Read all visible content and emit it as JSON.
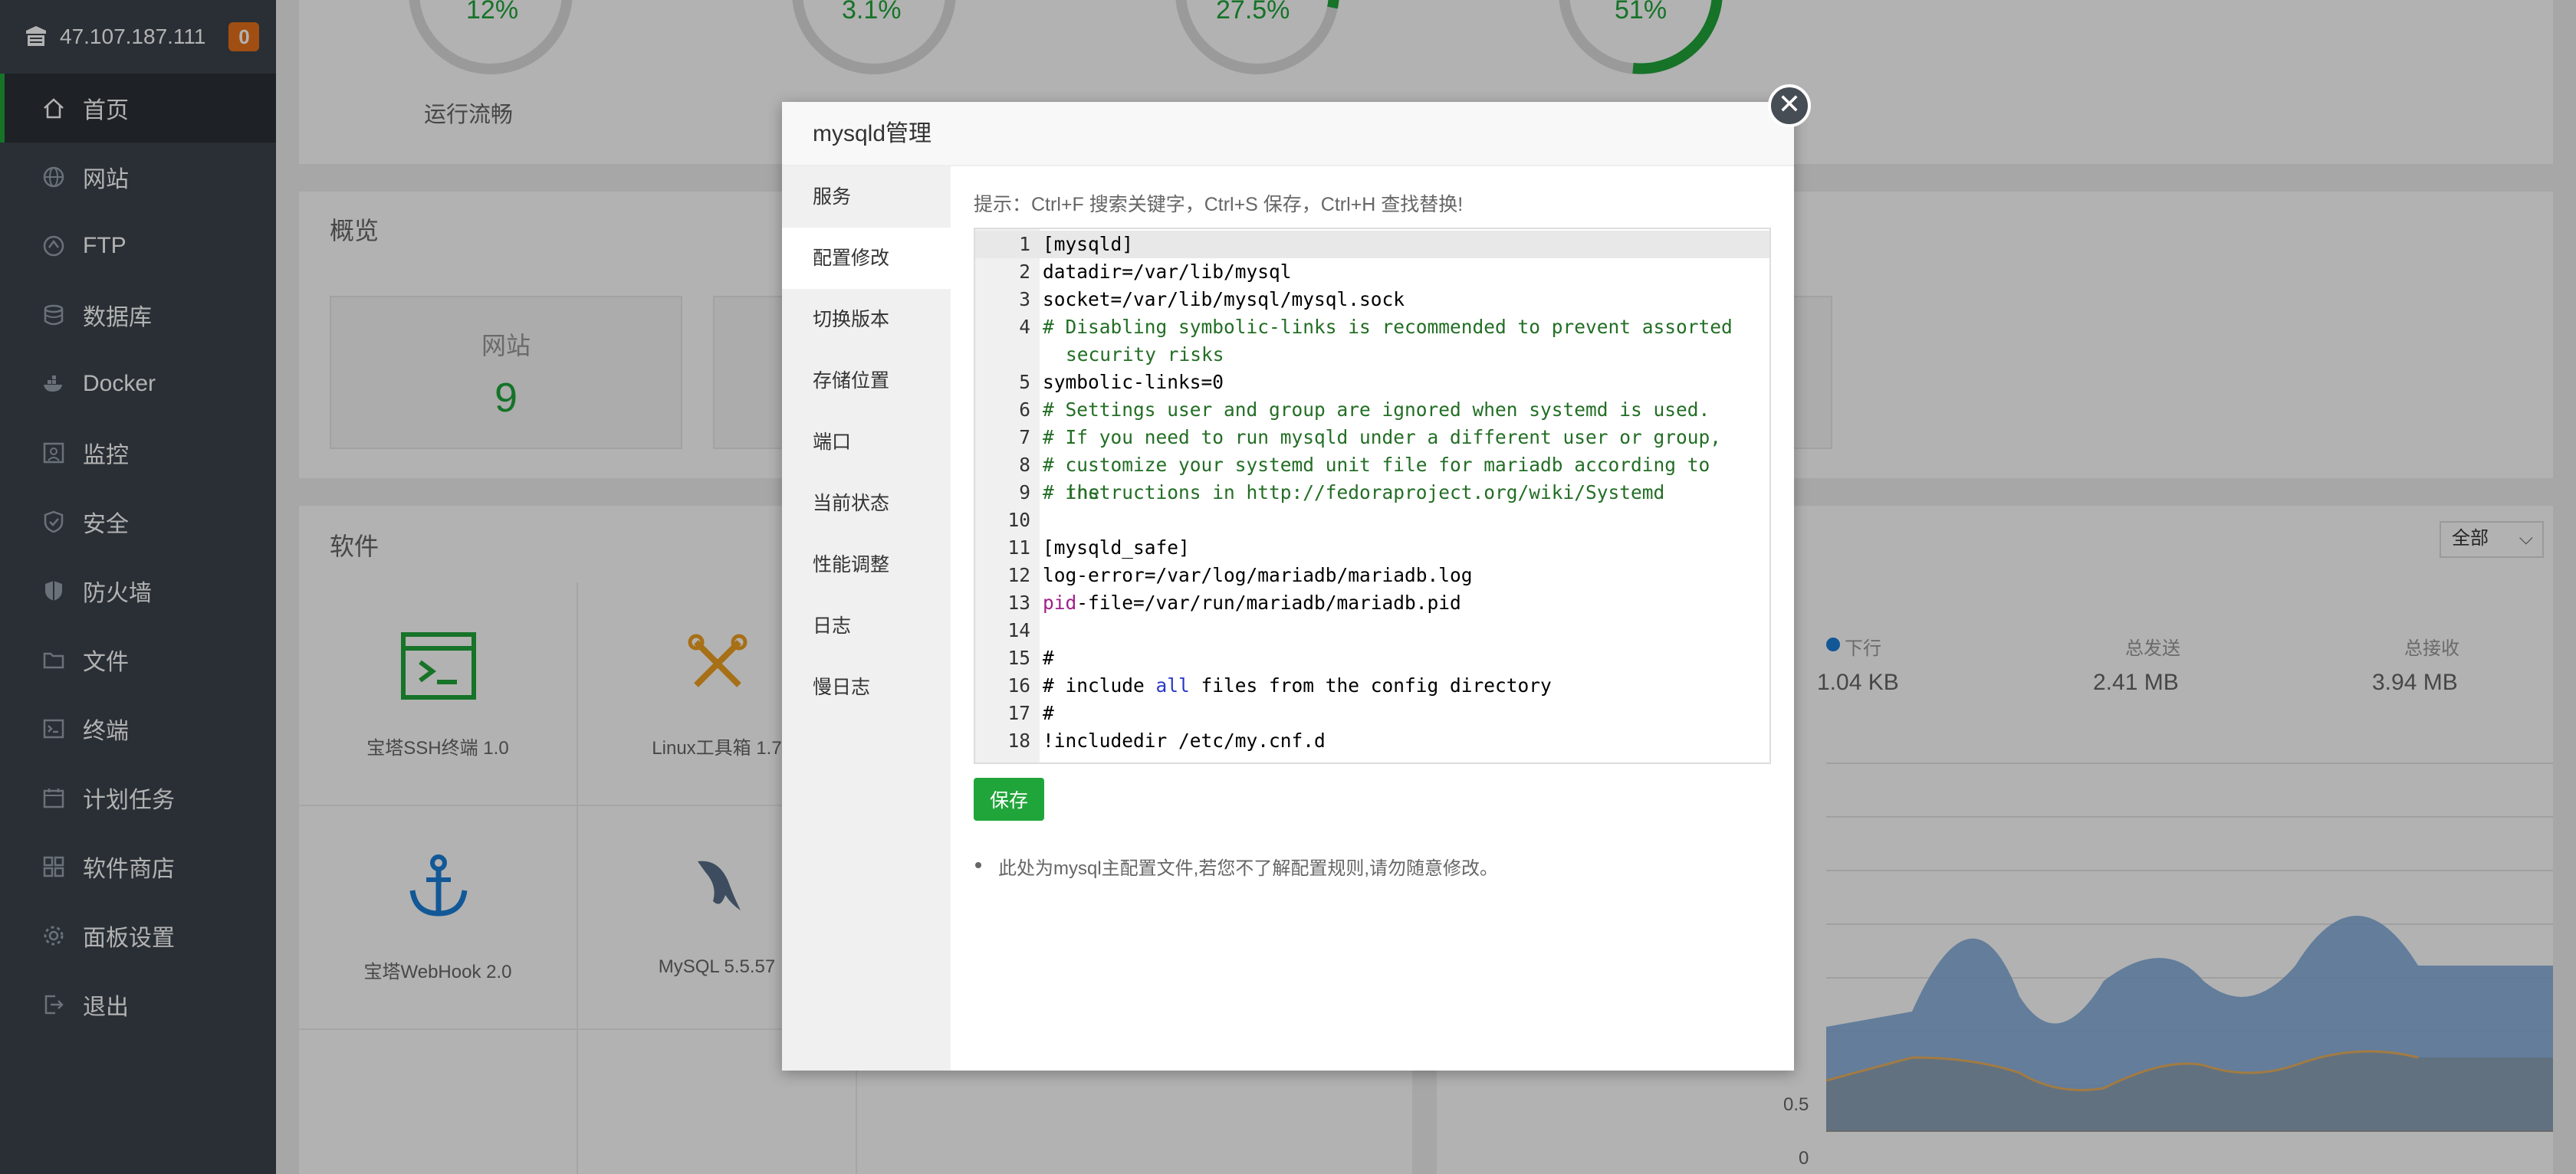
{
  "sidebar": {
    "ip": "47.107.187.111",
    "badge": "0",
    "items": [
      {
        "label": "首页",
        "icon": "home-icon"
      },
      {
        "label": "网站",
        "icon": "globe-icon"
      },
      {
        "label": "FTP",
        "icon": "ftp-icon"
      },
      {
        "label": "数据库",
        "icon": "database-icon"
      },
      {
        "label": "Docker",
        "icon": "docker-icon"
      },
      {
        "label": "监控",
        "icon": "monitor-icon"
      },
      {
        "label": "安全",
        "icon": "shield-check-icon"
      },
      {
        "label": "防火墙",
        "icon": "firewall-icon"
      },
      {
        "label": "文件",
        "icon": "folder-icon"
      },
      {
        "label": "终端",
        "icon": "terminal-icon"
      },
      {
        "label": "计划任务",
        "icon": "calendar-icon"
      },
      {
        "label": "软件商店",
        "icon": "grid-icon"
      },
      {
        "label": "面板设置",
        "icon": "gear-icon"
      },
      {
        "label": "退出",
        "icon": "logout-icon"
      }
    ]
  },
  "status": {
    "gauges": [
      {
        "pct": "12%",
        "label": "运行流畅"
      },
      {
        "pct": "3.1%",
        "label": ""
      },
      {
        "pct": "27.5%",
        "label": ""
      },
      {
        "pct": "51%",
        "label": ""
      }
    ]
  },
  "overview": {
    "title": "概览",
    "site_label": "网站",
    "site_count": "9"
  },
  "software": {
    "title": "软件",
    "filter": "全部",
    "items": [
      {
        "label": "宝塔SSH终端 1.0",
        "icon": "ssh-terminal-icon"
      },
      {
        "label": "Linux工具箱 1.7",
        "icon": "tools-icon"
      },
      {
        "label": "宝塔WebHook 2.0",
        "icon": "anchor-icon"
      },
      {
        "label": "MySQL 5.5.57",
        "icon": "mysql-dolphin-icon"
      }
    ]
  },
  "network": {
    "down_label": "下行",
    "down_value": "1.04 KB",
    "sent_label": "总发送",
    "sent_value": "2.41 MB",
    "recv_label": "总接收",
    "recv_value": "3.94 MB",
    "axis_05": "0.5",
    "axis_0": "0"
  },
  "modal": {
    "title": "mysqld管理",
    "nav": [
      "服务",
      "配置修改",
      "切换版本",
      "存储位置",
      "端口",
      "当前状态",
      "性能调整",
      "日志",
      "慢日志"
    ],
    "active_nav": "配置修改",
    "hint": "提示：Ctrl+F 搜索关键字，Ctrl+S 保存，Ctrl+H 查找替换!",
    "lines": [
      {
        "n": "1",
        "text": "[mysqld]"
      },
      {
        "n": "2",
        "text": "datadir=/var/lib/mysql"
      },
      {
        "n": "3",
        "text": "socket=/var/lib/mysql/mysql.sock"
      },
      {
        "n": "4",
        "text": "# Disabling symbolic-links is recommended to prevent assorted security risks"
      },
      {
        "n": "5",
        "text": "symbolic-links=0"
      },
      {
        "n": "6",
        "text": "# Settings user and group are ignored when systemd is used."
      },
      {
        "n": "7",
        "text": "# If you need to run mysqld under a different user or group,"
      },
      {
        "n": "8",
        "text": "# customize your systemd unit file for mariadb according to the"
      },
      {
        "n": "9",
        "text": "# instructions in http://fedoraproject.org/wiki/Systemd"
      },
      {
        "n": "10",
        "text": ""
      },
      {
        "n": "11",
        "text": "[mysqld_safe]"
      },
      {
        "n": "12",
        "text": "log-error=/var/log/mariadb/mariadb.log"
      },
      {
        "n": "13",
        "text_pre": "pid",
        "text": "-file=/var/run/mariadb/mariadb.pid"
      },
      {
        "n": "14",
        "text": ""
      },
      {
        "n": "15",
        "text": "#"
      },
      {
        "n": "16",
        "text_a": "# include ",
        "text_kw": "all",
        "text_b": " files from the config directory"
      },
      {
        "n": "17",
        "text": "#"
      },
      {
        "n": "18",
        "text": "!includedir /etc/my.cnf.d"
      }
    ],
    "save_label": "保存",
    "note": "此处为mysql主配置文件,若您不了解配置规则,请勿随意修改。",
    "close_symbol": "✕"
  }
}
